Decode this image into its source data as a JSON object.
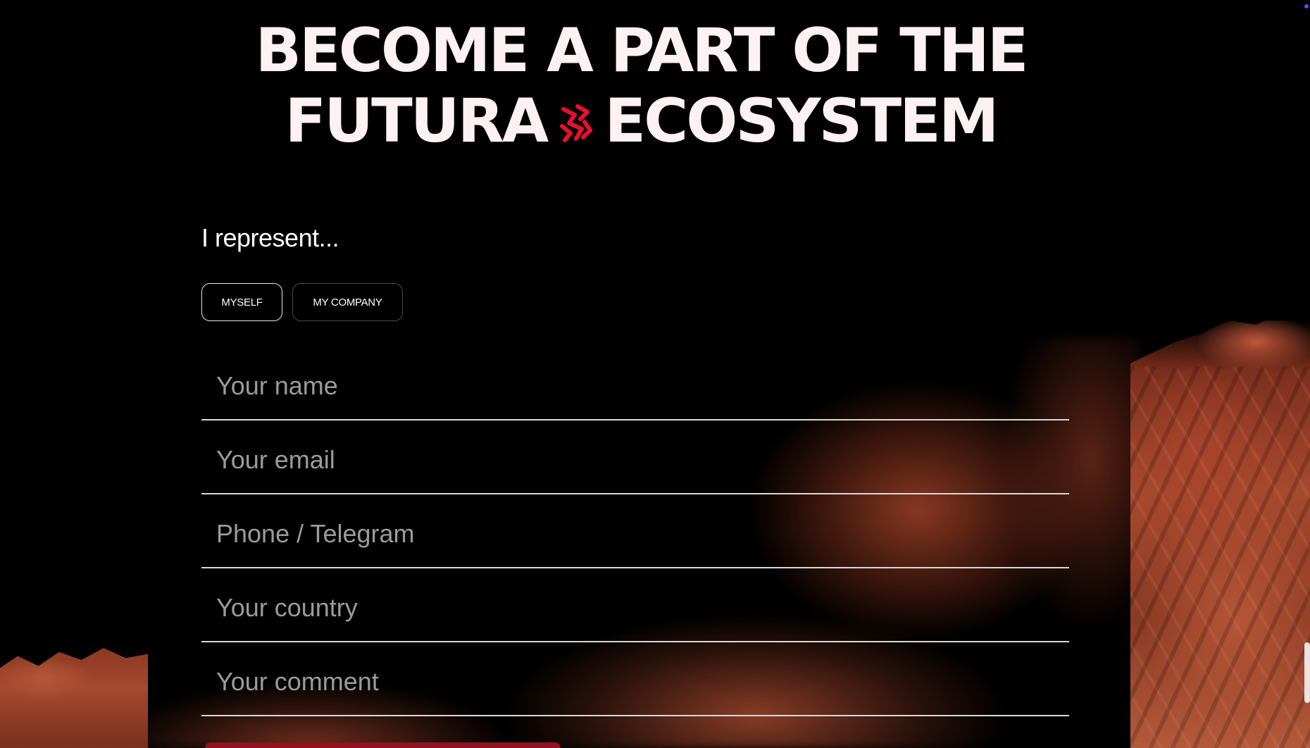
{
  "headline": {
    "line1": "BECOME A PART OF THE",
    "line2_left": "FUTURA",
    "line2_right": "ECOSYSTEM",
    "brand_icon": "futura-logo-icon",
    "brand_color": "#e8102d"
  },
  "form": {
    "represent_label": "I represent...",
    "choices": [
      {
        "label": "MYSELF",
        "selected": true
      },
      {
        "label": "MY COMPANY",
        "selected": false
      }
    ],
    "fields": {
      "name": {
        "value": "",
        "placeholder": "Your name"
      },
      "email": {
        "value": "",
        "placeholder": "Your email"
      },
      "phone": {
        "value": "",
        "placeholder": "Phone / Telegram"
      },
      "country": {
        "value": "",
        "placeholder": "Your country"
      },
      "comment": {
        "value": "",
        "placeholder": "Your comment"
      }
    },
    "submit_color": "#8e1420"
  },
  "colors": {
    "background": "#000000",
    "headline": "#fdf1f3",
    "placeholder": "#9b9b9b",
    "rock": "#a64a2d"
  }
}
